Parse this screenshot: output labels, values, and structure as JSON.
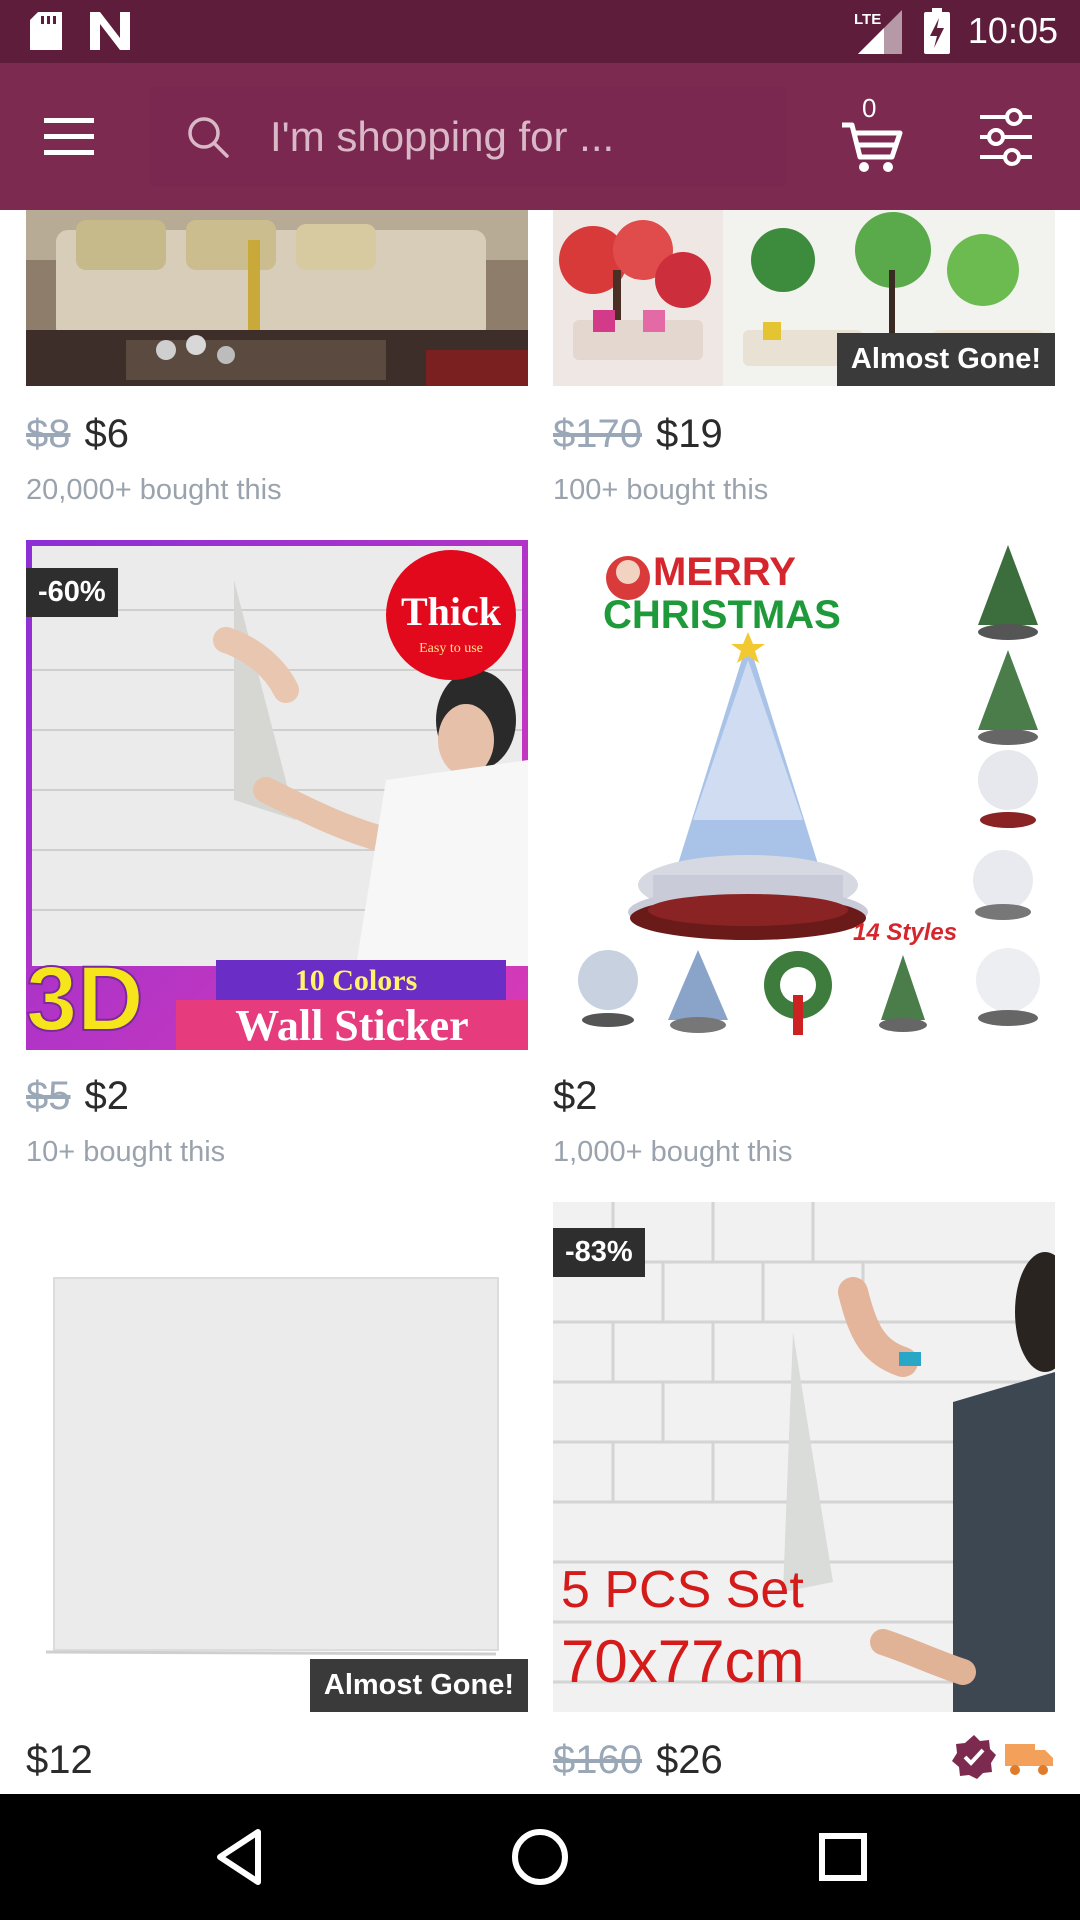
{
  "status_bar": {
    "time": "10:05",
    "network": "LTE",
    "icons": [
      "sd-card-icon",
      "notification-n-icon",
      "lte-signal-icon",
      "battery-charging-icon"
    ]
  },
  "app_bar": {
    "search_placeholder": "I'm shopping for ...",
    "cart_count": "0",
    "icons": [
      "menu-icon",
      "search-icon",
      "cart-icon",
      "filter-icon"
    ]
  },
  "products": [
    {
      "old_price": "$8",
      "price": "$6",
      "bought": "20,000+ bought this"
    },
    {
      "old_price": "$170",
      "price": "$19",
      "bought": "100+ bought this",
      "badge": "Almost Gone!"
    },
    {
      "old_price": "$5",
      "price": "$2",
      "bought": "10+ bought this",
      "discount": "-60%",
      "image_text": {
        "thick": "Thick",
        "easy": "Easy to use",
        "colors": "10 Colors",
        "big": "3D",
        "title": "Wall Sticker"
      }
    },
    {
      "price": "$2",
      "bought": "1,000+ bought this",
      "image_text": {
        "merry": "MERRY",
        "christmas": "CHRISTMAS",
        "styles": "14 Styles"
      }
    },
    {
      "price": "$12",
      "badge": "Almost Gone!"
    },
    {
      "old_price": "$160",
      "price": "$26",
      "discount": "-83%",
      "image_text": {
        "line1": "5 PCS Set",
        "line2": "70x77cm"
      }
    }
  ],
  "colors": {
    "status_bar": "#5e1d3b",
    "app_bar": "#7d2a51",
    "old_price": "#9aa7b6",
    "bought_text": "#9aa3ad",
    "verified_badge": "#7d2a51",
    "shipping_truck": "#f2a05a"
  }
}
